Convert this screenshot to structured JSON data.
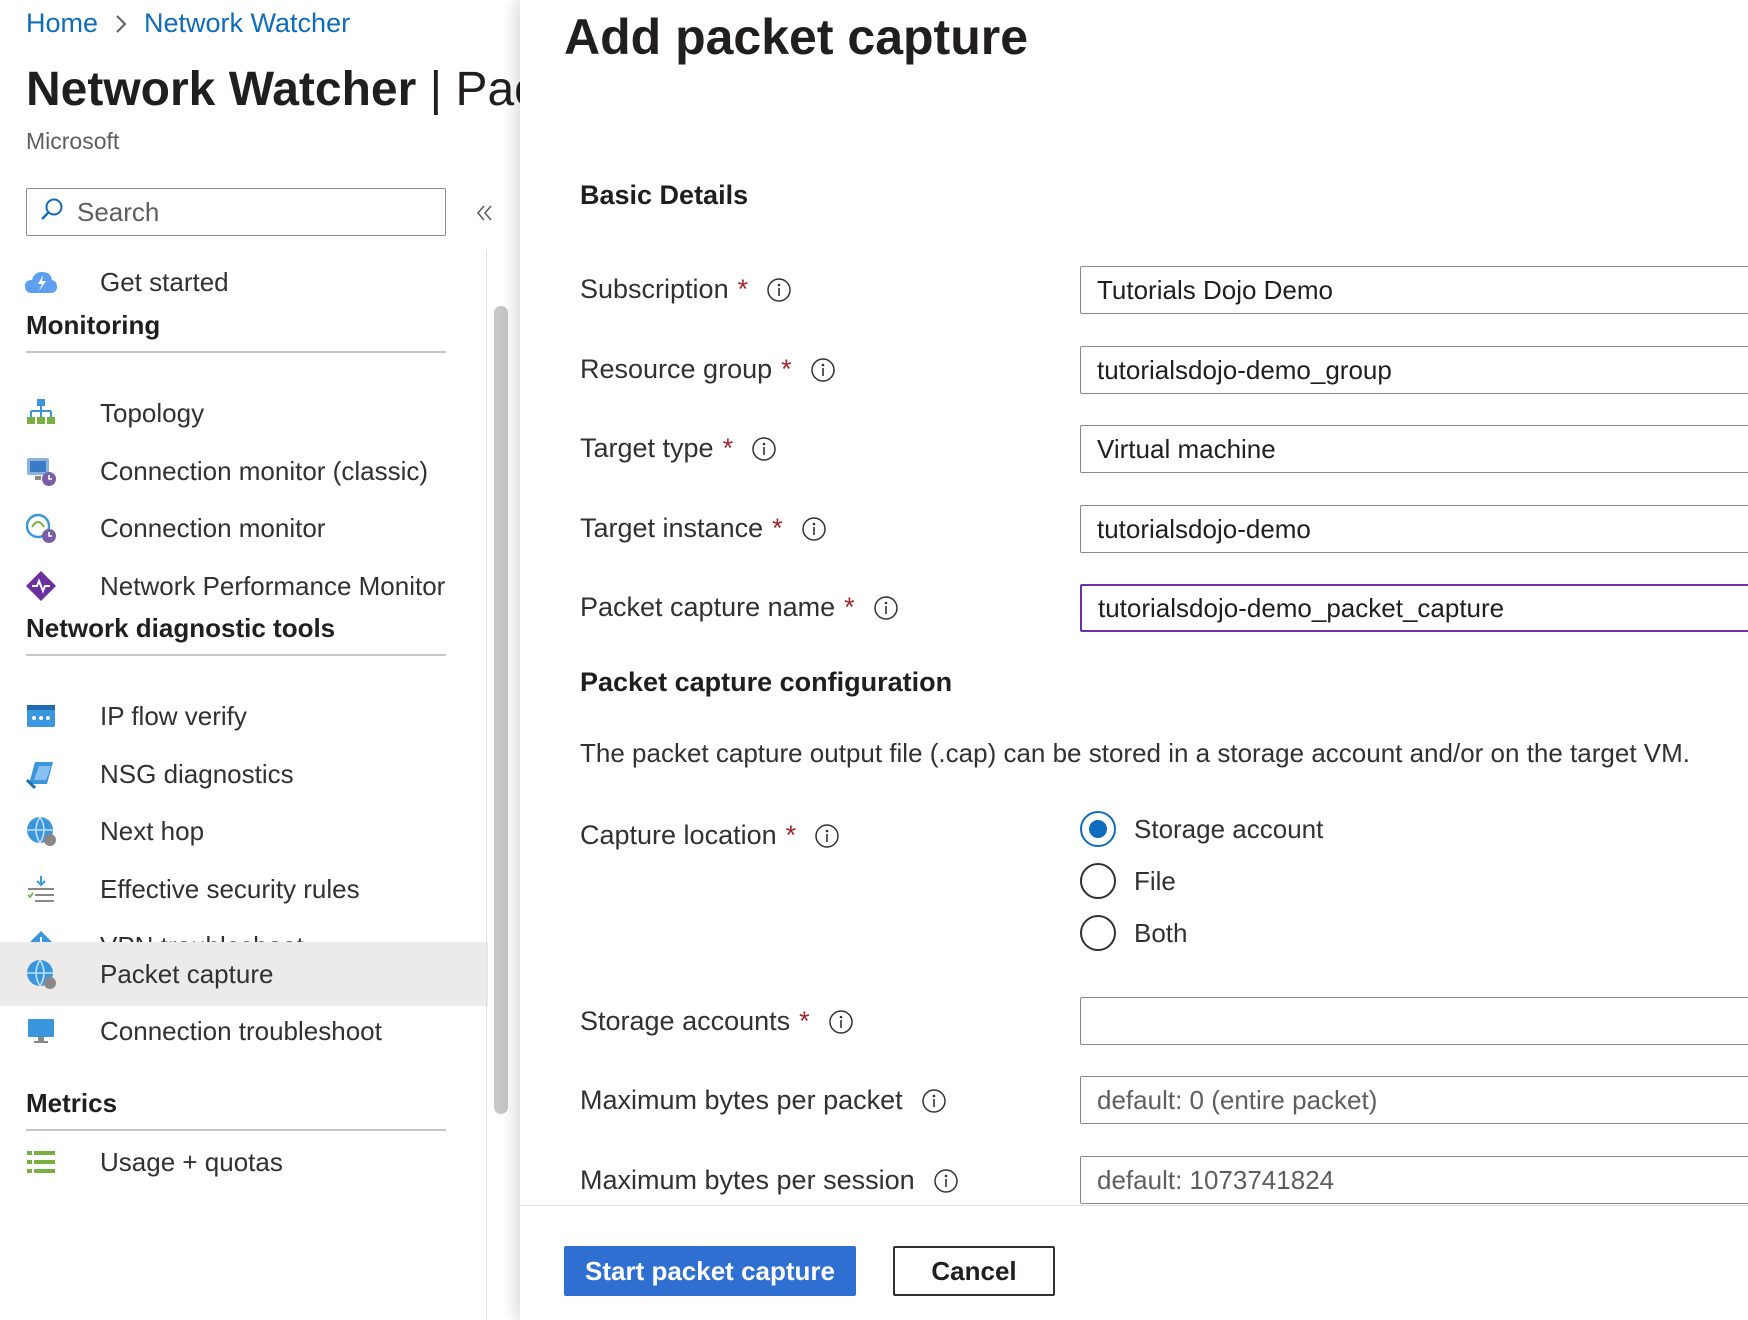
{
  "breadcrumb": {
    "home": "Home",
    "current": "Network Watcher"
  },
  "blade": {
    "title_bold": "Network Watcher",
    "title_rest": " | Pac",
    "subtitle": "Microsoft",
    "search_placeholder": "Search"
  },
  "nav": {
    "get_started": "Get started",
    "groups": {
      "monitoring": "Monitoring",
      "diagnostics": "Network diagnostic tools",
      "metrics": "Metrics"
    },
    "monitoring": [
      "Topology",
      "Connection monitor (classic)",
      "Connection monitor",
      "Network Performance Monitor"
    ],
    "diagnostics": [
      "IP flow verify",
      "NSG diagnostics",
      "Next hop",
      "Effective security rules",
      "VPN troubleshoot",
      "Packet capture",
      "Connection troubleshoot"
    ],
    "metrics": [
      "Usage + quotas"
    ],
    "active": "Packet capture"
  },
  "pane": {
    "title": "Add packet capture",
    "basic_details": "Basic Details",
    "subscription": {
      "label": "Subscription",
      "value": "Tutorials Dojo Demo"
    },
    "resource_group": {
      "label": "Resource group",
      "value": "tutorialsdojo-demo_group"
    },
    "target_type": {
      "label": "Target type",
      "value": "Virtual machine"
    },
    "target_instance": {
      "label": "Target instance",
      "value": "tutorialsdojo-demo"
    },
    "capture_name": {
      "label": "Packet capture name",
      "value": "tutorialsdojo-demo_packet_capture"
    },
    "config_heading": "Packet capture configuration",
    "config_desc": "The packet capture output file (.cap) can be stored in a storage account and/or on the target VM.",
    "capture_location": {
      "label": "Capture location",
      "options": [
        "Storage account",
        "File",
        "Both"
      ],
      "selected": "Storage account"
    },
    "storage_accounts": {
      "label": "Storage accounts",
      "value": ""
    },
    "max_bytes_packet": {
      "label": "Maximum bytes per packet",
      "placeholder": "default: 0 (entire packet)"
    },
    "max_bytes_session": {
      "label": "Maximum bytes per session",
      "placeholder": "default: 1073741824"
    },
    "required_marker": "*",
    "start_button": "Start packet capture",
    "cancel_button": "Cancel"
  },
  "colors": {
    "accent": "#0f6cbd",
    "primary_button": "#2f6fd1",
    "required": "#a4262c",
    "focus_border": "#6b2fa0",
    "active_nav": "#edebe9"
  }
}
